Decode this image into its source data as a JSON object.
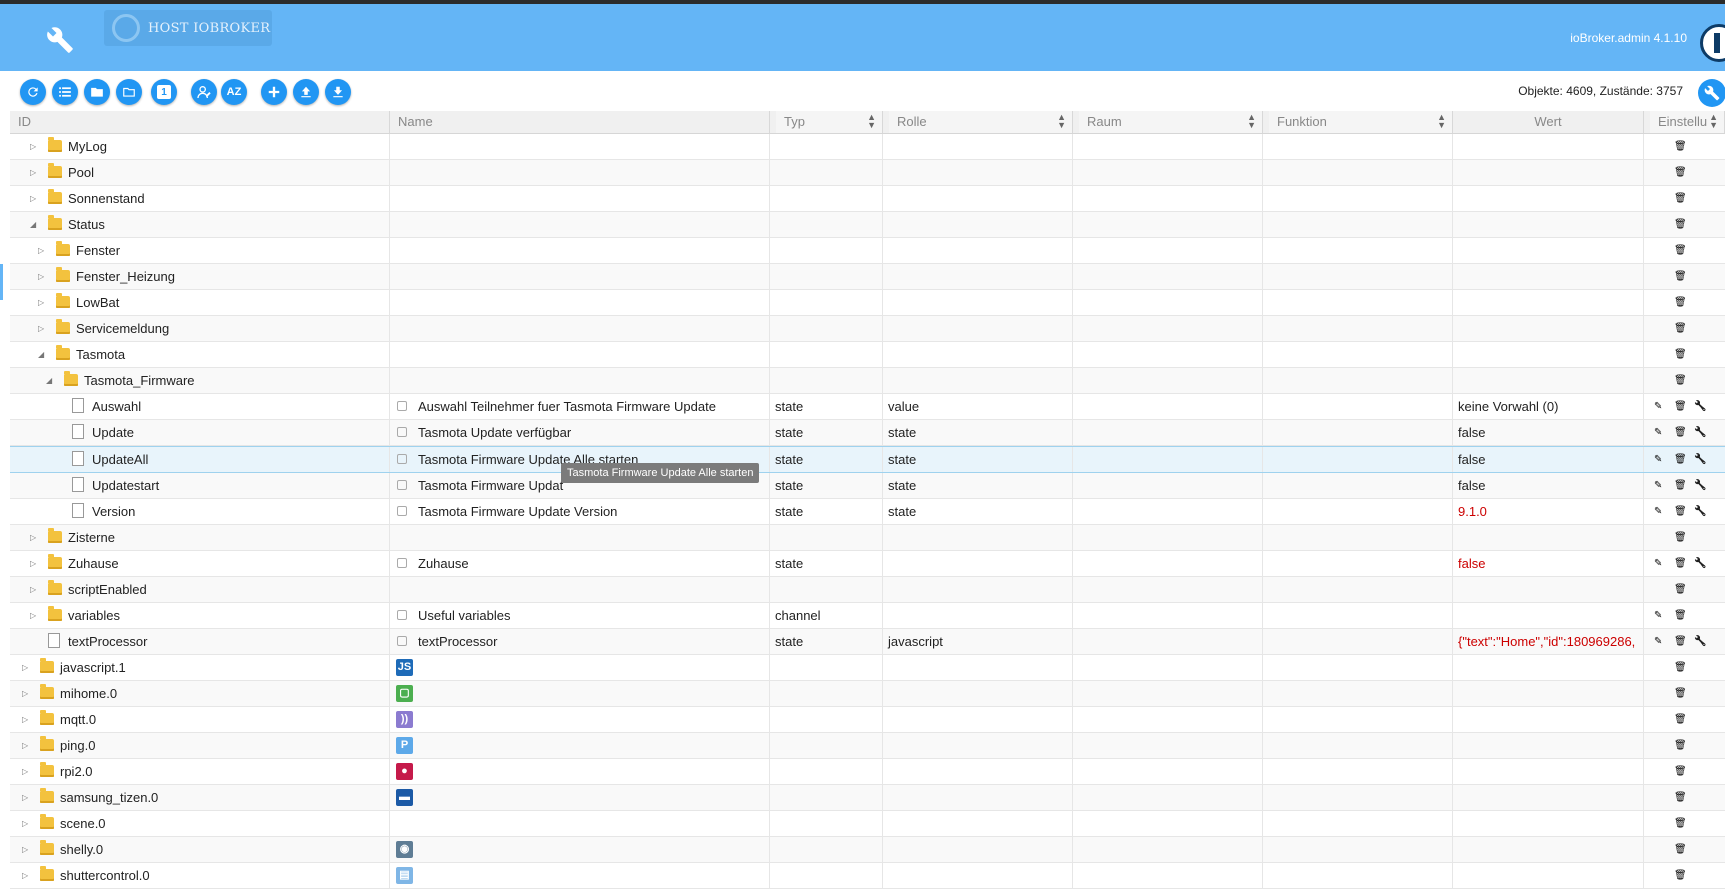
{
  "host": {
    "label": "HOST IOBROKER"
  },
  "app": {
    "version": "ioBroker.admin 4.1.10"
  },
  "status": {
    "counts": "Objekte: 4609, Zustände: 3757"
  },
  "toolbar": {
    "btn_one_label": "1",
    "btn_az_label": "AZ"
  },
  "columns": {
    "id": "ID",
    "name": "Name",
    "typ": "Typ",
    "rolle": "Rolle",
    "raum": "Raum",
    "funktion": "Funktion",
    "wert": "Wert",
    "einstellungen": "Einstellu"
  },
  "rows": [
    {
      "id": "MyLog",
      "name": "",
      "typ": "",
      "rolle": "",
      "wert": ""
    },
    {
      "id": "Pool",
      "name": "",
      "typ": "",
      "rolle": "",
      "wert": ""
    },
    {
      "id": "Sonnenstand",
      "name": "",
      "typ": "",
      "rolle": "",
      "wert": ""
    },
    {
      "id": "Status",
      "name": "",
      "typ": "",
      "rolle": "",
      "wert": ""
    },
    {
      "id": "Fenster",
      "name": "",
      "typ": "",
      "rolle": "",
      "wert": ""
    },
    {
      "id": "Fenster_Heizung",
      "name": "",
      "typ": "",
      "rolle": "",
      "wert": ""
    },
    {
      "id": "LowBat",
      "name": "",
      "typ": "",
      "rolle": "",
      "wert": ""
    },
    {
      "id": "Servicemeldung",
      "name": "",
      "typ": "",
      "rolle": "",
      "wert": ""
    },
    {
      "id": "Tasmota",
      "name": "",
      "typ": "",
      "rolle": "",
      "wert": ""
    },
    {
      "id": "Tasmota_Firmware",
      "name": "",
      "typ": "",
      "rolle": "",
      "wert": ""
    },
    {
      "id": "Auswahl",
      "name": "Auswahl Teilnehmer fuer Tasmota Firmware Update",
      "typ": "state",
      "rolle": "value",
      "wert": "keine Vorwahl (0)"
    },
    {
      "id": "Update",
      "name": "Tasmota Update verfügbar",
      "typ": "state",
      "rolle": "state",
      "wert": "false"
    },
    {
      "id": "UpdateAll",
      "name": "Tasmota Firmware Update Alle starten",
      "typ": "state",
      "rolle": "state",
      "wert": "false"
    },
    {
      "id": "Updatestart",
      "name": "Tasmota Firmware Updat",
      "typ": "state",
      "rolle": "state",
      "wert": "false"
    },
    {
      "id": "Version",
      "name": "Tasmota Firmware Update Version",
      "typ": "state",
      "rolle": "state",
      "wert": "9.1.0"
    },
    {
      "id": "Zisterne",
      "name": "",
      "typ": "",
      "rolle": "",
      "wert": ""
    },
    {
      "id": "Zuhause",
      "name": "Zuhause",
      "typ": "state",
      "rolle": "",
      "wert": "false"
    },
    {
      "id": "scriptEnabled",
      "name": "",
      "typ": "",
      "rolle": "",
      "wert": ""
    },
    {
      "id": "variables",
      "name": "Useful variables",
      "typ": "channel",
      "rolle": "",
      "wert": ""
    },
    {
      "id": "textProcessor",
      "name": "textProcessor",
      "typ": "state",
      "rolle": "javascript",
      "wert": "{\"text\":\"Home\",\"id\":180969286,"
    },
    {
      "id": "javascript.1",
      "name": "",
      "typ": "",
      "rolle": "",
      "wert": "",
      "icon": "js-icon"
    },
    {
      "id": "mihome.0",
      "name": "",
      "typ": "",
      "rolle": "",
      "wert": "",
      "icon": "mihome-icon"
    },
    {
      "id": "mqtt.0",
      "name": "",
      "typ": "",
      "rolle": "",
      "wert": "",
      "icon": "mqtt-icon"
    },
    {
      "id": "ping.0",
      "name": "",
      "typ": "",
      "rolle": "",
      "wert": "",
      "icon": "ping-icon"
    },
    {
      "id": "rpi2.0",
      "name": "",
      "typ": "",
      "rolle": "",
      "wert": "",
      "icon": "raspberry-icon"
    },
    {
      "id": "samsung_tizen.0",
      "name": "",
      "typ": "",
      "rolle": "",
      "wert": "",
      "icon": "samsung-icon"
    },
    {
      "id": "scene.0",
      "name": "",
      "typ": "",
      "rolle": "",
      "wert": ""
    },
    {
      "id": "shelly.0",
      "name": "",
      "typ": "",
      "rolle": "",
      "wert": "",
      "icon": "shelly-icon"
    },
    {
      "id": "shuttercontrol.0",
      "name": "",
      "typ": "",
      "rolle": "",
      "wert": "",
      "icon": "shuttercontrol-icon"
    }
  ],
  "tooltip": {
    "text": "Tasmota Firmware Update Alle starten"
  },
  "colors": {
    "header_bg": "#64b5f6",
    "button_bg": "#2196f3",
    "value_red": "#cc0000",
    "folder": "#f3c23e"
  }
}
